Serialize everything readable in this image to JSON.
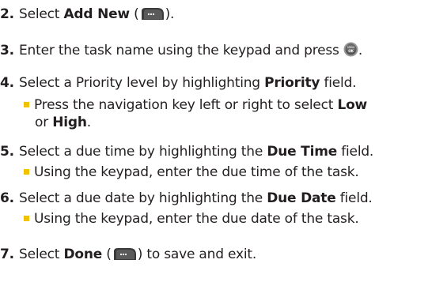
{
  "steps": [
    {
      "num": "2.",
      "pre": "Select ",
      "bold": "Add New",
      "post": " (",
      "post2": ")."
    },
    {
      "num": "3.",
      "text": "Enter the task name using the keypad and press ",
      "end": "."
    },
    {
      "num": "4.",
      "pre": "Select a Priority level by highlighting ",
      "bold": "Priority",
      "post": " field.",
      "sub": {
        "pre": "Press the navigation key left or right to select ",
        "bold1": "Low",
        "mid": "or ",
        "bold2": "High",
        "post": "."
      }
    },
    {
      "num": "5.",
      "pre": "Select a due time by highlighting the ",
      "bold": "Due Time",
      "post": " field.",
      "sub": {
        "text": "Using the keypad, enter the due time of the task."
      }
    },
    {
      "num": "6.",
      "pre": "Select a due date by highlighting the ",
      "bold": "Due Date",
      "post": " field.",
      "sub": {
        "text": "Using the keypad, enter the due date of the task."
      }
    },
    {
      "num": "7.",
      "pre": "Select ",
      "bold": "Done",
      "post": " (",
      "post2": ") to save and exit."
    }
  ],
  "icons": {
    "softkey": "right-softkey-icon",
    "menu": "menu-ok-button-icon"
  },
  "colors": {
    "bullet": "#f2c100",
    "text": "#231f20"
  }
}
